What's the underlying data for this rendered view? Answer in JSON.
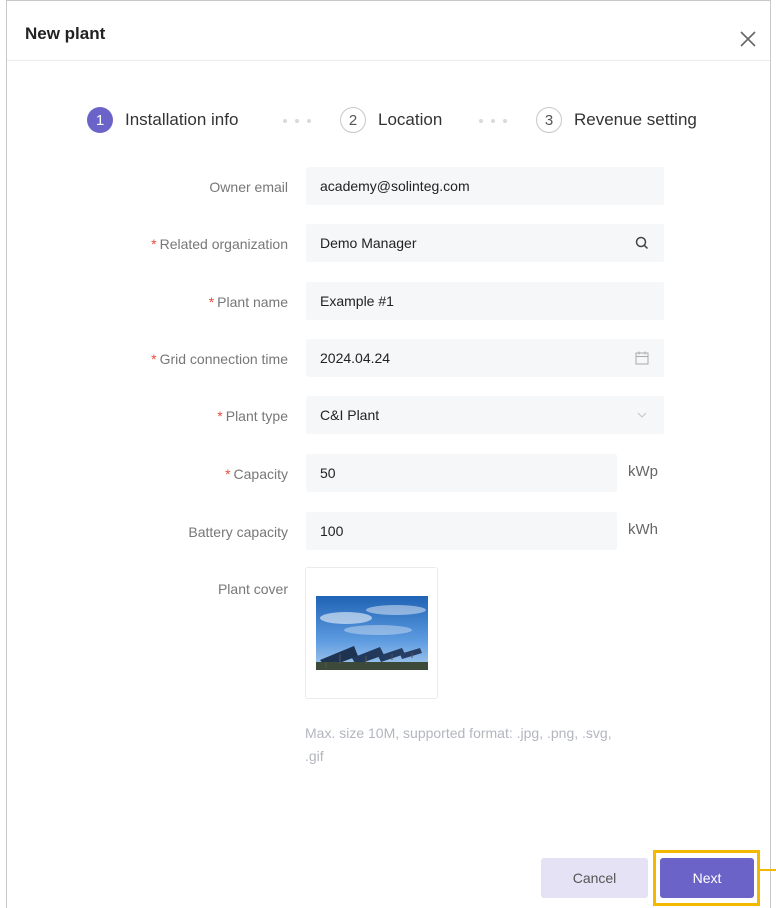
{
  "dialog": {
    "title": "New plant",
    "close_icon": "close-icon"
  },
  "steps": [
    {
      "number": "1",
      "label": "Installation info",
      "active": true
    },
    {
      "number": "2",
      "label": "Location",
      "active": false
    },
    {
      "number": "3",
      "label": "Revenue setting",
      "active": false
    }
  ],
  "form": {
    "owner_email": {
      "label": "Owner email",
      "value": "academy@solinteg.com",
      "required": false
    },
    "related_organization": {
      "label": "Related organization",
      "value": "Demo Manager",
      "required": true,
      "icon": "search-icon"
    },
    "plant_name": {
      "label": "Plant name",
      "value": "Example #1",
      "required": true
    },
    "grid_connection_time": {
      "label": "Grid connection time",
      "value": "2024.04.24",
      "required": true,
      "icon": "calendar-icon"
    },
    "plant_type": {
      "label": "Plant type",
      "value": "C&I Plant",
      "required": true,
      "icon": "chevron-down-icon"
    },
    "capacity": {
      "label": "Capacity",
      "value": "50",
      "unit": "kWp",
      "required": true
    },
    "battery_capacity": {
      "label": "Battery capacity",
      "value": "100",
      "unit": "kWh",
      "required": false
    },
    "plant_cover": {
      "label": "Plant cover",
      "image": "solar-panels-photo"
    },
    "upload_hint_line1": "Max. size 10M, supported format: .jpg, .png, .svg,",
    "upload_hint_line2": ".gif"
  },
  "required_mark": "*",
  "buttons": {
    "cancel": "Cancel",
    "next": "Next"
  },
  "colors": {
    "accent": "#6c63c9",
    "required": "#e74c3c",
    "highlight": "#f5b800"
  }
}
